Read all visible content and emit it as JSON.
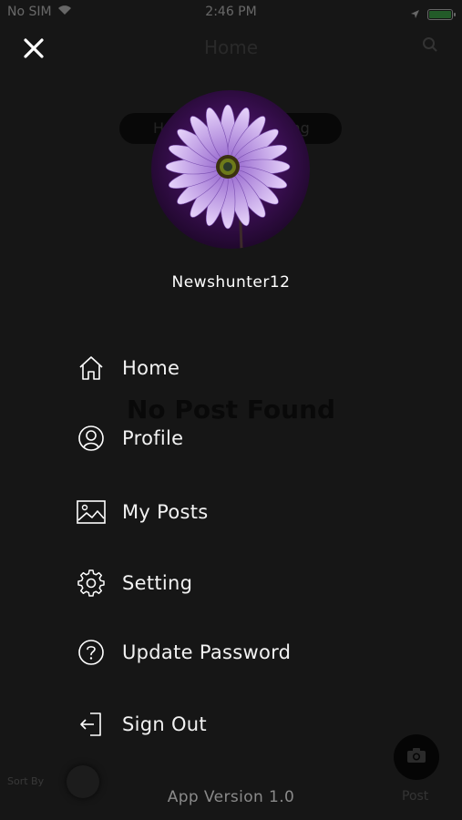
{
  "status_bar": {
    "carrier": "No SIM",
    "time": "2:46 PM"
  },
  "background": {
    "title": "Home",
    "toggle_left": "H",
    "toggle_right": "ing",
    "empty_message": "No Post Found",
    "sort_label": "Sort By",
    "post_label": "Post"
  },
  "drawer": {
    "username": "Newshunter12",
    "menu": [
      {
        "label": "Home",
        "icon": "home-icon"
      },
      {
        "label": "Profile",
        "icon": "user-icon"
      },
      {
        "label": "My Posts",
        "icon": "image-icon"
      },
      {
        "label": "Setting",
        "icon": "gear-icon"
      },
      {
        "label": "Update Password",
        "icon": "question-icon"
      },
      {
        "label": "Sign Out",
        "icon": "sign-out-icon"
      }
    ],
    "app_version": "App Version 1.0"
  },
  "colors": {
    "background": "#161616",
    "text": "#ffffff",
    "muted_text": "#8a8a8a",
    "battery": "#3ddc4e",
    "avatar_flower": "#b48ee0"
  }
}
